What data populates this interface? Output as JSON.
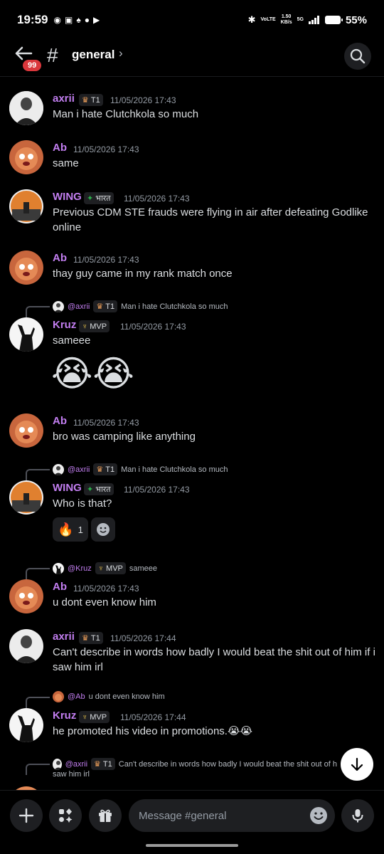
{
  "status_bar": {
    "time": "19:59",
    "network_top": "VoLTE",
    "speed_value": "1.50",
    "speed_unit": "KB/s",
    "network_gen": "5G",
    "battery": "55%"
  },
  "header": {
    "unread_badge": "99",
    "channel_prefix": "#",
    "channel_name": "general",
    "chevron": "›"
  },
  "colors": {
    "username": "#c27ef0",
    "background": "#000000",
    "surface": "#1e1f22",
    "timestamp": "#949ba4",
    "mention_badge": "#da373c"
  },
  "messages": [
    {
      "author": "axrii",
      "role": "T1",
      "role_icon": "crown-icon",
      "time": "11/05/2026 17:43",
      "text": "Man i hate Clutchkola so much"
    },
    {
      "author": "Ab",
      "time": "11/05/2026 17:43",
      "text": "same"
    },
    {
      "author": "WING",
      "role": "भारत",
      "role_icon": "flag-icon",
      "time": "11/05/2026 17:43",
      "text": "Previous CDM STE frauds were flying in air after defeating Godlike online"
    },
    {
      "author": "Ab",
      "time": "11/05/2026 17:43",
      "text": "thay guy came in my rank match once"
    },
    {
      "reply_to": "@axrii",
      "reply_role": "T1",
      "reply_text": "Man i hate Clutchkola so much",
      "author": "Kruz",
      "role": "MVP",
      "role_icon": "wings-icon",
      "time": "11/05/2026 17:43",
      "text": "sameee",
      "emojis": "😭😭"
    },
    {
      "author": "Ab",
      "time": "11/05/2026 17:43",
      "text": "bro was camping like anything"
    },
    {
      "reply_to": "@axrii",
      "reply_role": "T1",
      "reply_text": "Man i hate Clutchkola so much",
      "author": "WING",
      "role": "भारत",
      "role_icon": "flag-icon",
      "time": "11/05/2026 17:43",
      "text": "Who is that?",
      "reactions": [
        {
          "emoji": "🔥",
          "count": "1"
        }
      ]
    },
    {
      "reply_to": "@Kruz",
      "reply_role": "MVP",
      "reply_text": "sameee",
      "author": "Ab",
      "time": "11/05/2026 17:43",
      "text": "u dont even know him"
    },
    {
      "author": "axrii",
      "role": "T1",
      "role_icon": "crown-icon",
      "time": "11/05/2026 17:44",
      "text": "Can't describe in words how badly I would beat the shit out of him if i saw him irl"
    },
    {
      "reply_to": "@Ab",
      "reply_text": "u dont even know him",
      "author": "Kruz",
      "role": "MVP",
      "role_icon": "wings-icon",
      "time": "11/05/2026 17:44",
      "text": "he promoted his video in promotions.😭😭"
    },
    {
      "reply_to": "@axrii",
      "reply_role": "T1",
      "reply_text": "Can't describe in words how badly I would beat the shit out of h",
      "reply_text_2": "saw him irl"
    }
  ],
  "input": {
    "placeholder": "Message #general"
  },
  "icons": [
    "back-arrow-icon",
    "search-icon",
    "plus-icon",
    "apps-icon",
    "gift-icon",
    "emoji-icon",
    "microphone-icon",
    "arrow-down-icon"
  ]
}
